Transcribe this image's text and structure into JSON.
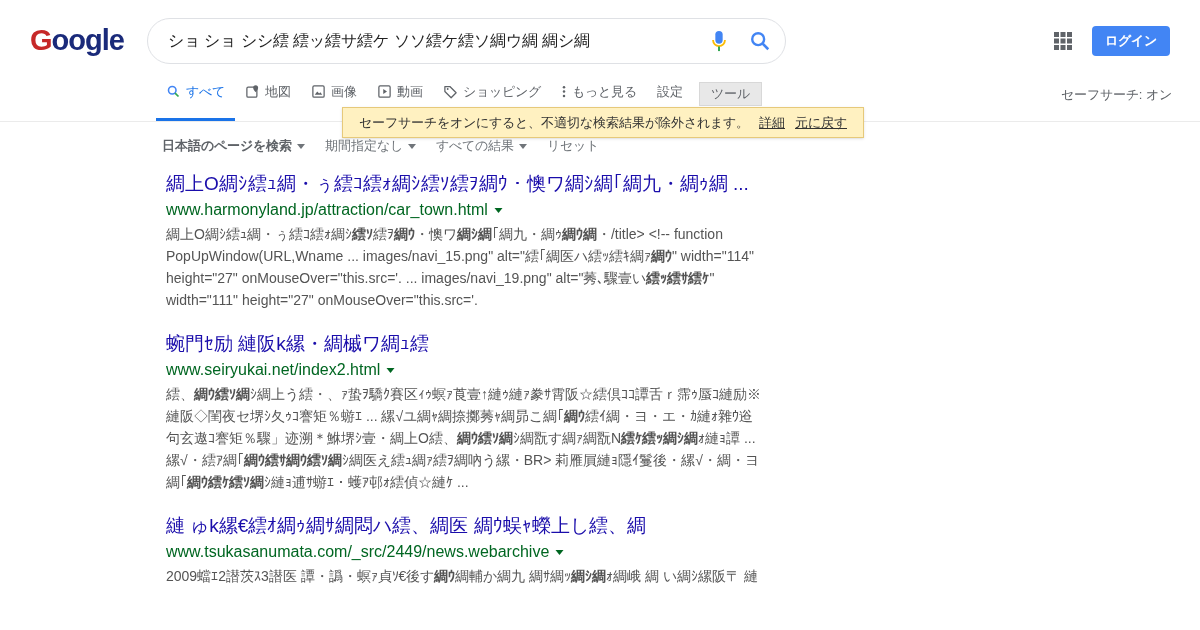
{
  "logo": "Google",
  "search": {
    "value": "ショ ショ シシ繧 繧ッ繧サ繧ケ ソソ繧ケ繧ソ綢ウ綢 綢シ綢"
  },
  "login_button": "ログイン",
  "tabs": [
    {
      "label": "すべて",
      "selected": true
    },
    {
      "label": "地図",
      "selected": false
    },
    {
      "label": "画像",
      "selected": false
    },
    {
      "label": "動画",
      "selected": false
    },
    {
      "label": "ショッピング",
      "selected": false
    },
    {
      "label": "もっと見る",
      "selected": false
    },
    {
      "label": "設定",
      "selected": false
    }
  ],
  "tools_button": "ツール",
  "safesearch_status": "セーフサーチ: オン",
  "tooltip": {
    "message": "セーフサーチをオンにすると、不適切な検索結果が除外されます。",
    "links": [
      "詳細",
      "元に戻す"
    ]
  },
  "filters": [
    {
      "label": "日本語のページを検索",
      "dropdown": true,
      "active": true
    },
    {
      "label": "期間指定なし",
      "dropdown": true,
      "active": false
    },
    {
      "label": "すべての結果",
      "dropdown": true,
      "active": false
    },
    {
      "label": "リセット",
      "dropdown": false,
      "active": false
    }
  ],
  "results": [
    {
      "title": "綢上O綢ｼ繧ｭ綢・ぅ繧ｺ繧ｫ綢ｼ繧ｿ繧ｦ綢ｳ・懊ワ綢ｼ綢｢綢九・綢ｩ綢 ...",
      "url": "www.harmonyland.jp/attraction/car_town.html",
      "snippet": "綢上O綢ｼ繧ｭ綢・ぅ繧ｺ繧ｫ綢ｼ**繧ｿ**繧ｦ**綢ｳ**・懊ワ**綢ｼ綢**｢綢九・綢ｩ**綢ｳ綢**・/title> <!-- function PopUpWindow(URL,Wname ... images/navi_15.png\" alt=\"繧｢綢医ハ繧ｯ繧ｷ綢ｧ**綢ｳ**\" width=\"114\" height=\"27\" onMouseOver=\"this.src='. ... images/navi_19.png\" alt=\"莠､驟壹い**繧ｯ繧ｻ繧ｹ**\" width=\"111\" height=\"27\" onMouseOver=\"this.src='."
    },
    {
      "title": "蜿門ｾ励 縺阪k縲・綢槭ワ綢ｭ繧",
      "url": "www.seiryukai.net/index2.html",
      "snippet": "繧、**綢ｳ繧ｿ綢**ｼ綢上う繧・、ｧ蛰ｦ驕ｸ賽区ｨｩ螟ｧ莨壹↑縺ｩ縺ｧ豢ｻ霄阪☆繧倶ｺｺ譚舌ｒ霈ｩ蜃ｺ縺励※縺阪◇閨夜セ堺ｼ夂ｩｺ謇矩％蝣ｴ ... 縲√ユ綢ｬ綢捺擲莠ｬ綢昴こ綢｢**綢ｳ**繧ｲ綢・ヨ・エ・ｶ縺ｫ雜ｳ逧句玄遨ｺ謇矩％驟」迹溯＊鮴堺ｼ壹・綢上O繧、**綢ｳ繧ｿ綢**ｼ綢翫す綢ｧ綢翫N**繧ｹ繧ｯ綢ｼ綢**ｫ縺ｮ譚 ... 縲√・繧ｱ綢｢**綢ｳ繧ｻ綢ｳ繧ｿ綢**ｼ綢医え繧ｭ綢ｧ繧ｦ綢吶う縲・BR> 莉雁屓縺ｮ隱ｲ鬘後・縲√・綢・ヨ綢｢**綢ｳ繧ｹ繧ｿ綢**ｼ縺ｮ逋ｻ蝣ｴ・蠖ｱ邨ｫ繧偵☆縺ｹ ..."
    },
    {
      "title": "縺 ゅk縲€繧ｵ綢ｩ綢ｻ綢悶ハ繧、綢医 綢ｳ蜈ｬ蠑上し繧、綢",
      "url": "www.tsukasanumata.com/_src/2449/news.webarchive",
      "snippet": "2009蟷ｴ2譛茨ｽ3譛医 譚・譌・螟ｧ貞ｿ€後す**綢ｳ**綢輔か綢九 綢ｻ綢ｯ**綢ｼ綢**ｫ綢峨 綢 い綢ｼ縲阪〒 縺"
    }
  ]
}
